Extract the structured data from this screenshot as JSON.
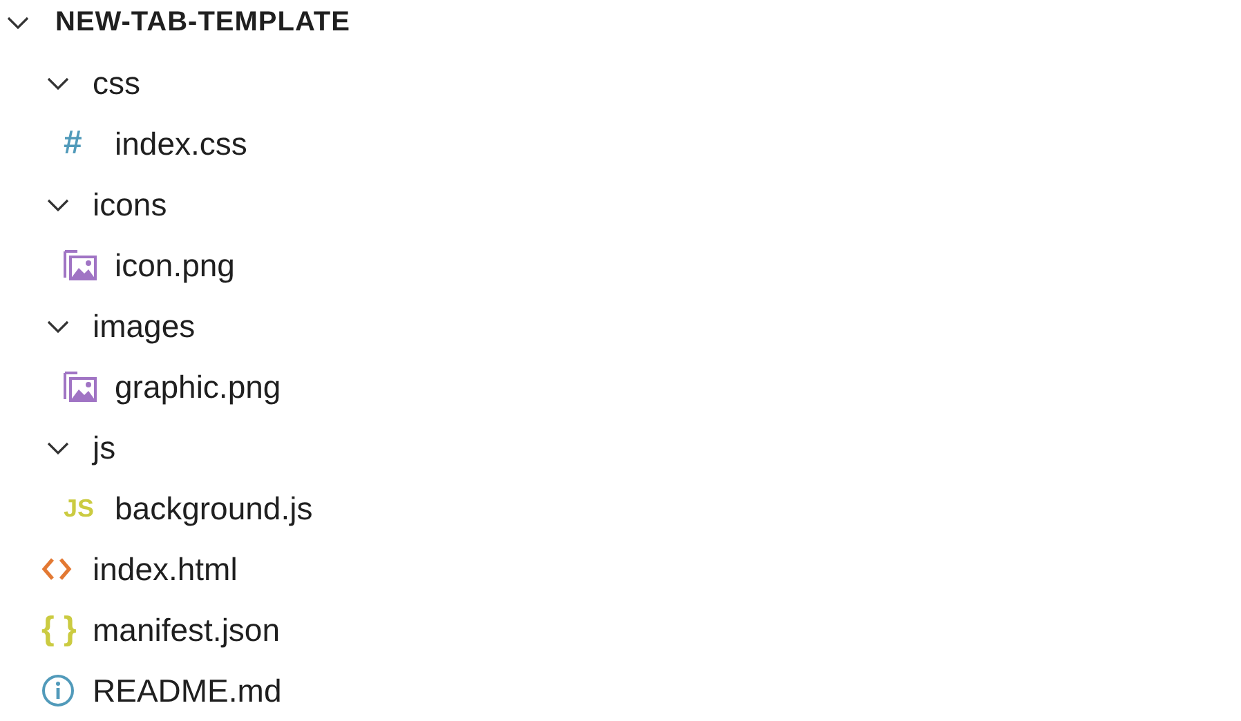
{
  "explorer": {
    "title": "NEW-TAB-TEMPLATE",
    "expanded": true,
    "children": [
      {
        "name": "css",
        "kind": "folder",
        "expanded": true,
        "children": [
          {
            "name": "index.css",
            "kind": "css",
            "icon": "#"
          }
        ]
      },
      {
        "name": "icons",
        "kind": "folder",
        "expanded": true,
        "children": [
          {
            "name": "icon.png",
            "kind": "image"
          }
        ]
      },
      {
        "name": "images",
        "kind": "folder",
        "expanded": true,
        "children": [
          {
            "name": "graphic.png",
            "kind": "image"
          }
        ]
      },
      {
        "name": "js",
        "kind": "folder",
        "expanded": true,
        "children": [
          {
            "name": "background.js",
            "kind": "js",
            "icon": "JS"
          }
        ]
      },
      {
        "name": "index.html",
        "kind": "html"
      },
      {
        "name": "manifest.json",
        "kind": "json",
        "icon": "{ }"
      },
      {
        "name": "README.md",
        "kind": "info"
      }
    ]
  }
}
